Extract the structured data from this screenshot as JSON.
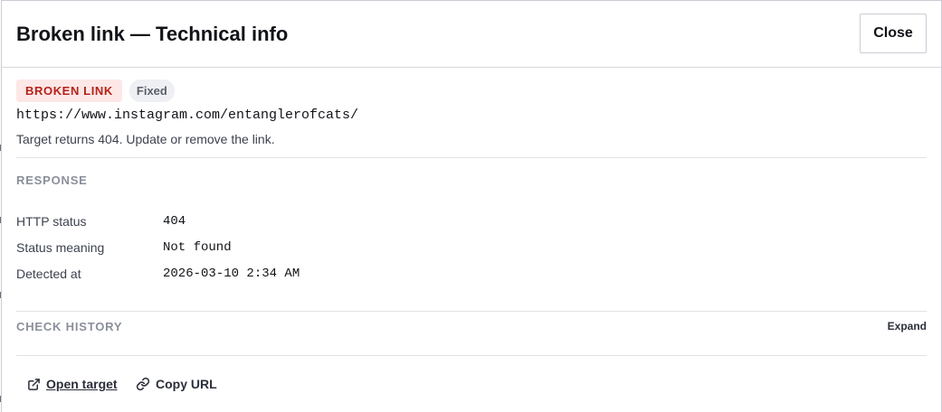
{
  "dialog": {
    "title": "Broken link — Technical info",
    "close_label": "Close"
  },
  "status": {
    "badge_label": "BROKEN LINK",
    "state_label": "Fixed",
    "url": "https://www.instagram.com/entanglerofcats/",
    "description": "Target returns 404. Update or remove the link."
  },
  "response": {
    "section_label": "RESPONSE",
    "rows": [
      {
        "key": "HTTP status",
        "value": "404"
      },
      {
        "key": "Status meaning",
        "value": "Not found"
      },
      {
        "key": "Detected at",
        "value": "2026-03-10 2:34 AM"
      }
    ]
  },
  "check_history": {
    "section_label": "CHECK HISTORY",
    "expand_label": "Expand"
  },
  "actions": {
    "open_target_label": "Open target",
    "open_target_icon": "external-link-icon",
    "copy_url_label": "Copy URL",
    "copy_url_icon": "link-icon"
  },
  "colors": {
    "badge_broken_bg": "#fde7e7",
    "badge_broken_text": "#b42318",
    "badge_fixed_bg": "#eef0f3"
  }
}
